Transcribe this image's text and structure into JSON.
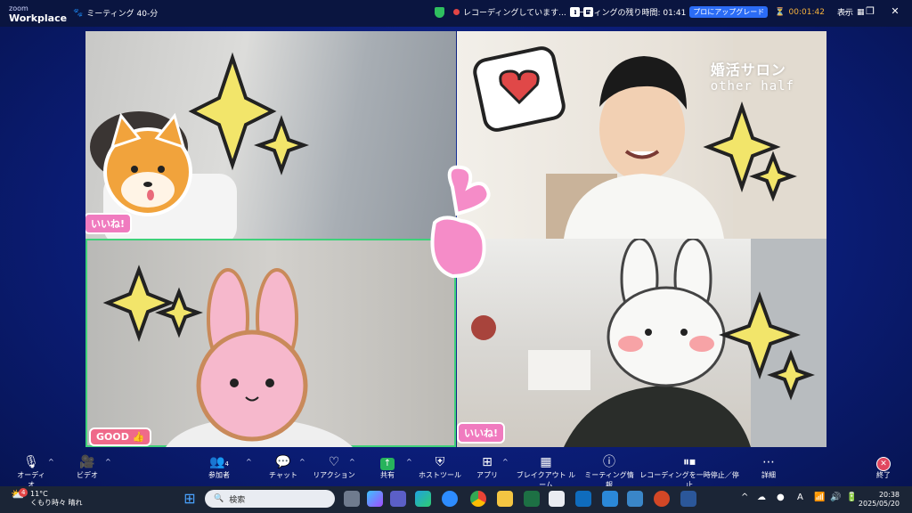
{
  "app": {
    "logo_top": "zoom",
    "logo_bottom": "Workplace",
    "meeting_title": "ミーティング 40-分"
  },
  "status": {
    "recording": "レコーディングしています...",
    "remaining": "ミーティングの残り時間: 01:41",
    "upgrade": "プロにアップグレード",
    "timer": "00:01:42",
    "view": "表示"
  },
  "video": {
    "salon_title": "婚活サロン",
    "salon_subtitle": "other half",
    "badge_like_1": "いいね!",
    "badge_good": "GOOD",
    "badge_like_2": "いいね!"
  },
  "toolbar": {
    "audio": "オーディオ",
    "video": "ビデオ",
    "participants": "参加者",
    "participants_count": "4",
    "chat": "チャット",
    "reactions": "リアクション",
    "share": "共有",
    "host_tools": "ホストツール",
    "apps": "アプリ",
    "breakout": "ブレイクアウト ルーム",
    "meeting_info": "ミーティング情報",
    "rec_pause": "レコーディングを一時停止／停止",
    "more": "詳細",
    "end": "終了"
  },
  "taskbar": {
    "weather_temp": "11°C",
    "weather_text": "くもり時々 晴れ",
    "weather_badge": "4",
    "search_placeholder": "検索",
    "time": "20:38",
    "date": "2025/05/20",
    "lang": "A"
  },
  "colors": {
    "accent_green": "#3fd07a",
    "record_red": "#e24545",
    "upgrade_blue": "#2b6cf6",
    "timer_orange": "#f6b23c",
    "reaction_pink": "#f07bbf"
  }
}
